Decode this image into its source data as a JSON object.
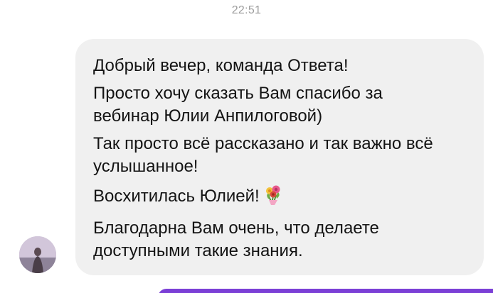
{
  "timestamp": "22:51",
  "message": {
    "paragraphs": [
      "Добрый вечер, команда Ответа!",
      "Просто хочу сказать Вам спасибо за вебинар Юлии Анпилоговой)",
      "Так просто всё рассказано и так важно всё услышанное!",
      "Восхитилась Юлией!",
      "Благодарна Вам очень, что делаете доступными такие знания."
    ],
    "bubble_color": "#f0f0f0",
    "text_color": "#141414"
  },
  "icons": {
    "avatar": "avatar",
    "emoji": "flowers-icon"
  },
  "colors": {
    "outgoing_bubble": "#7b3fd6",
    "timestamp": "#9c9c9c"
  }
}
